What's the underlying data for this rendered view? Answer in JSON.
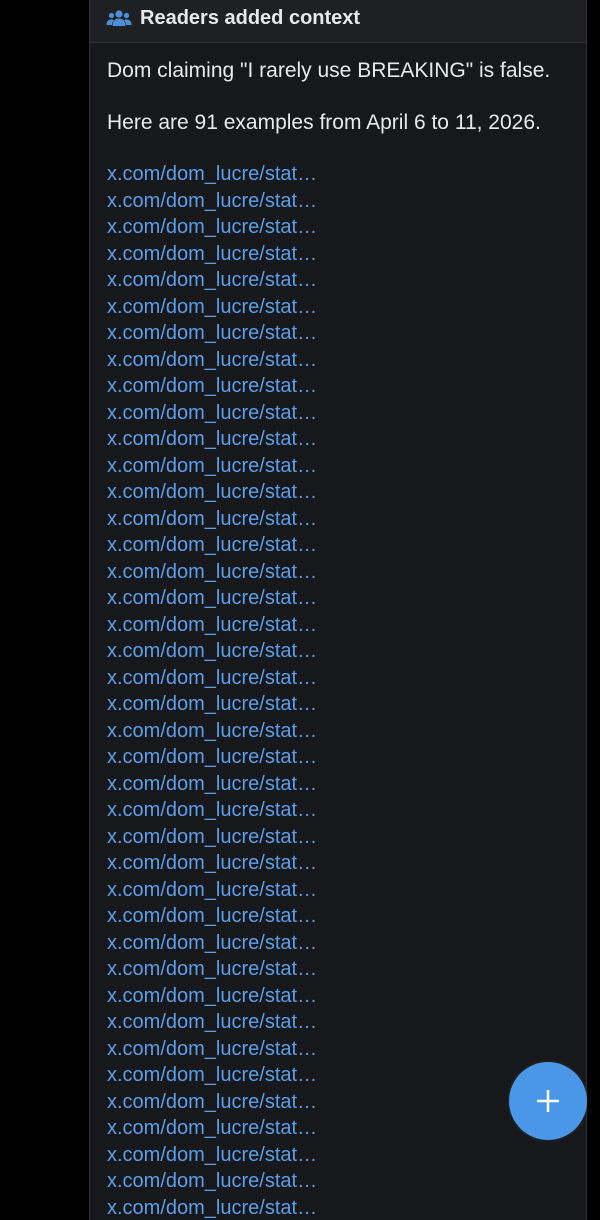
{
  "note": {
    "header_title": "Readers added context",
    "header_icon": "people-icon",
    "line1": "Dom claiming \"I rarely use BREAKING\" is false.",
    "line2": "Here are 91 examples from April 6 to 11, 2026.",
    "links": [
      "x.com/dom_lucre/stat…",
      "x.com/dom_lucre/stat…",
      "x.com/dom_lucre/stat…",
      "x.com/dom_lucre/stat…",
      "x.com/dom_lucre/stat…",
      "x.com/dom_lucre/stat…",
      "x.com/dom_lucre/stat…",
      "x.com/dom_lucre/stat…",
      "x.com/dom_lucre/stat…",
      "x.com/dom_lucre/stat…",
      "x.com/dom_lucre/stat…",
      "x.com/dom_lucre/stat…",
      "x.com/dom_lucre/stat…",
      "x.com/dom_lucre/stat…",
      "x.com/dom_lucre/stat…",
      "x.com/dom_lucre/stat…",
      "x.com/dom_lucre/stat…",
      "x.com/dom_lucre/stat…",
      "x.com/dom_lucre/stat…",
      "x.com/dom_lucre/stat…",
      "x.com/dom_lucre/stat…",
      "x.com/dom_lucre/stat…",
      "x.com/dom_lucre/stat…",
      "x.com/dom_lucre/stat…",
      "x.com/dom_lucre/stat…",
      "x.com/dom_lucre/stat…",
      "x.com/dom_lucre/stat…",
      "x.com/dom_lucre/stat…",
      "x.com/dom_lucre/stat…",
      "x.com/dom_lucre/stat…",
      "x.com/dom_lucre/stat…",
      "x.com/dom_lucre/stat…",
      "x.com/dom_lucre/stat…",
      "x.com/dom_lucre/stat…",
      "x.com/dom_lucre/stat…",
      "x.com/dom_lucre/stat…",
      "x.com/dom_lucre/stat…",
      "x.com/dom_lucre/stat…",
      "x.com/dom_lucre/stat…",
      "x.com/dom_lucre/stat…"
    ]
  },
  "fab": {
    "icon": "plus-icon",
    "color": "#4a97e8"
  },
  "colors": {
    "background": "#000000",
    "card": "#17181c",
    "text": "#e7e9ea",
    "link": "#5c9ee8"
  }
}
